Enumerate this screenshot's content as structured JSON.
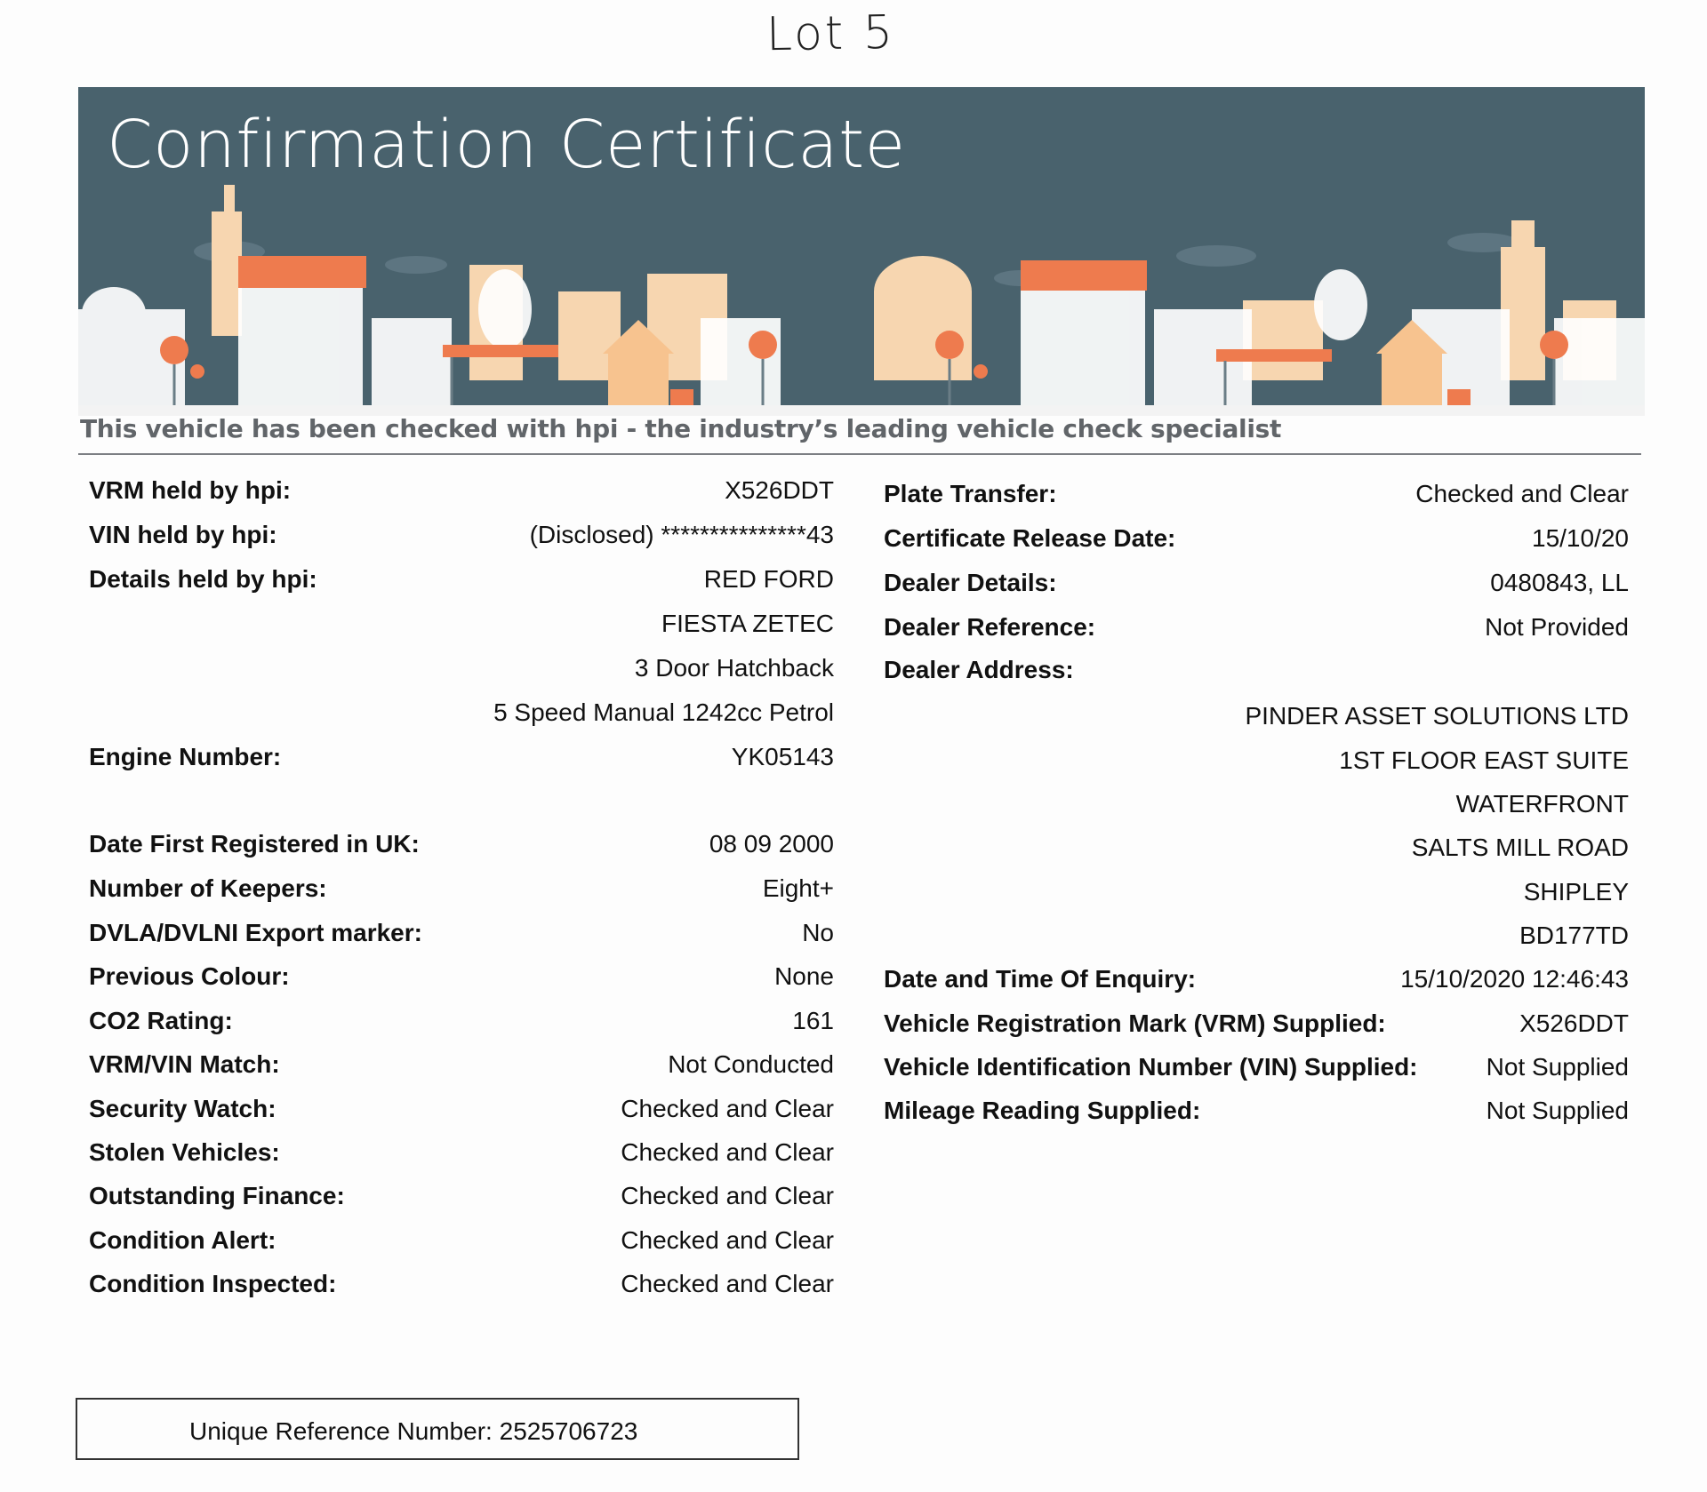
{
  "handwritten_note": "Lot 5",
  "banner": {
    "title": "Confirmation Certificate",
    "tagline": "This vehicle has been checked with hpi - the industry’s leading vehicle check specialist",
    "colors": {
      "background": "#49626d",
      "orange": "#ee7b4e",
      "peach": "#f7c38f",
      "white": "#ffffff"
    }
  },
  "left": {
    "vrm_label": "VRM held by hpi:",
    "vrm_value": "X526DDT",
    "vin_label": "VIN held by hpi:",
    "vin_value": "(Disclosed) ***************43",
    "details_label": "Details held by hpi:",
    "details_lines": [
      "RED FORD",
      "FIESTA ZETEC",
      "3 Door Hatchback",
      "5 Speed Manual 1242cc Petrol"
    ],
    "engine_label": "Engine Number:",
    "engine_value": "YK05143",
    "first_reg_label": "Date First Registered in UK:",
    "first_reg_value": "08 09 2000",
    "keepers_label": "Number of Keepers:",
    "keepers_value": "Eight+",
    "export_label": "DVLA/DVLNI Export marker:",
    "export_value": "No",
    "prev_colour_label": "Previous Colour:",
    "prev_colour_value": "None",
    "co2_label": "CO2 Rating:",
    "co2_value": "161",
    "vrm_vin_label": "VRM/VIN Match:",
    "vrm_vin_value": "Not Conducted",
    "security_label": "Security Watch:",
    "security_value": "Checked and Clear",
    "stolen_label": "Stolen Vehicles:",
    "stolen_value": "Checked and Clear",
    "finance_label": "Outstanding Finance:",
    "finance_value": "Checked and Clear",
    "cond_alert_label": "Condition Alert:",
    "cond_alert_value": "Checked and Clear",
    "cond_insp_label": "Condition Inspected:",
    "cond_insp_value": "Checked and Clear"
  },
  "right": {
    "plate_label": "Plate Transfer:",
    "plate_value": "Checked and Clear",
    "release_label": "Certificate Release Date:",
    "release_value": "15/10/20",
    "dealer_details_label": "Dealer Details:",
    "dealer_details_value": "0480843, LL",
    "dealer_ref_label": "Dealer Reference:",
    "dealer_ref_value": "Not Provided",
    "dealer_addr_label": "Dealer Address:",
    "dealer_addr_lines": [
      "PINDER ASSET SOLUTIONS LTD",
      "1ST FLOOR EAST SUITE",
      "WATERFRONT",
      "SALTS MILL ROAD",
      "SHIPLEY",
      "BD177TD"
    ],
    "enquiry_label": "Date and Time Of Enquiry:",
    "enquiry_value": "15/10/2020 12:46:43",
    "vrm_supplied_label": "Vehicle Registration Mark (VRM) Supplied:",
    "vrm_supplied_value": "X526DDT",
    "vin_supplied_label": "Vehicle Identification Number (VIN) Supplied:",
    "vin_supplied_value": "Not Supplied",
    "mileage_label": "Mileage Reading Supplied:",
    "mileage_value": "Not Supplied"
  },
  "urn": {
    "text": "Unique Reference Number: 2525706723"
  }
}
